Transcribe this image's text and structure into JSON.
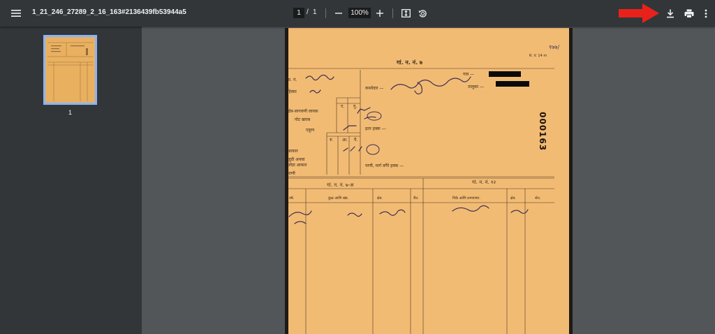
{
  "toolbar": {
    "title": "1_21_246_27289_2_16_163#2136439fb53944a5",
    "current_page": "1",
    "page_separator": "/",
    "total_pages": "1",
    "zoom": "100%",
    "menu_icon": "hamburger-menu-icon",
    "zoom_out_icon": "minus-icon",
    "zoom_in_icon": "plus-icon",
    "fit_icon": "fit-to-page-icon",
    "rotate_icon": "rotate-counterclockwise-icon",
    "download_icon": "download-icon",
    "print_icon": "print-icon",
    "more_icon": "more-vert-icon",
    "annotation_arrow_color": "#e8221b"
  },
  "sidebar": {
    "thumbnails": [
      {
        "page_number": "1",
        "selected": true
      }
    ],
    "selected_border_color": "#8ab4f8"
  },
  "document": {
    "paper_color": "#f0b46a",
    "corner_number": "१७७/",
    "rv_code": "R. V. 14 m",
    "form_title": "गां. न. नं. ७",
    "village_label": "गाव —",
    "survey_label": "स. नं.",
    "hissa_label": "हिस्सा",
    "holder_label": "कब्जेदार —",
    "taluka_label": "तालुका —",
    "col_e": "ए.",
    "col_g": "गु.",
    "cultivable_label": "क्षेत्र-लागवणी लायक",
    "pot_kharab_label": "पोट खराब",
    "total_label": "एकूण",
    "other_rights_label": "इतर हक्क —",
    "col_r": "रु.",
    "col_aa": "आ.",
    "col_p": "पै.",
    "assessment_label": "आकार",
    "judi_label": "जुडी अथवा",
    "extra_assessment_label": "जोडा आकार",
    "water_label": "पाणी",
    "water_rights_label": "पाणी, मार्ग वगैरे हक्क —",
    "stamp_number": "000163",
    "form7a_title": "गां. न. नं. ७-अ",
    "form12_title": "गां. न. नं. १२",
    "col_year": "वर्ष.",
    "col_mode": "कुळ आणि खंड.",
    "col_area": "क्षेत्र.",
    "col_rent": "रीत.",
    "col_crop": "पिके आणि लागवणार.",
    "col_area2": "क्षेत्र.",
    "col_remarks": "शेरा."
  }
}
